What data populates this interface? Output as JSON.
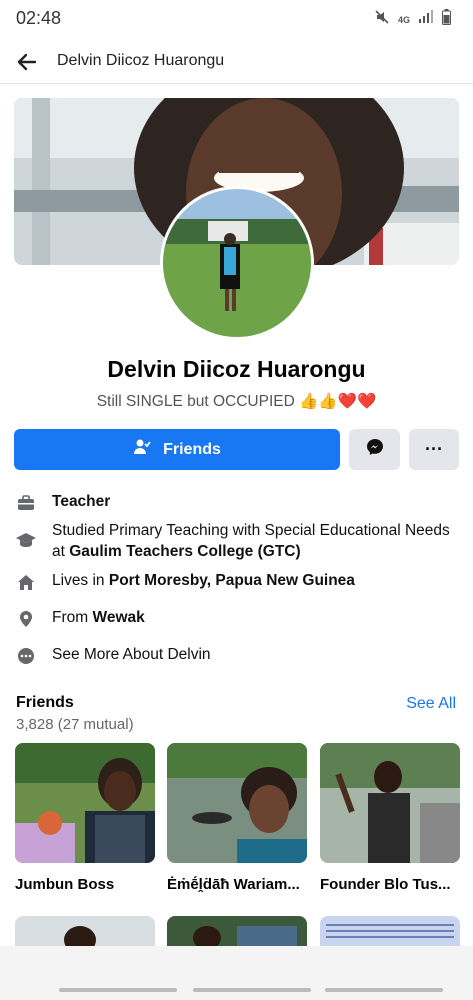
{
  "status_bar": {
    "time": "02:48",
    "network": "4G"
  },
  "top_bar": {
    "title": "Delvin Diicoz Huarongu"
  },
  "profile": {
    "name": "Delvin Diicoz Huarongu",
    "bio": "Still SINGLE but OCCUPIED 👍👍❤️❤️"
  },
  "actions": {
    "friends_label": "Friends",
    "more_label": "···"
  },
  "about": {
    "work": "Teacher",
    "education_prefix": "Studied Primary Teaching with Special Educational Needs at ",
    "education_school": "Gaulim Teachers College (GTC)",
    "lives_prefix": "Lives in ",
    "lives_place": "Port Moresby, Papua New Guinea",
    "from_prefix": "From ",
    "from_place": "Wewak",
    "see_more": "See More About Delvin"
  },
  "friends": {
    "heading": "Friends",
    "count": "3,828 (27 mutual)",
    "see_all": "See All",
    "items": [
      {
        "name": "Jumbun Boss"
      },
      {
        "name": "Ėṁḗḽḋāħ Wariam..."
      },
      {
        "name": "Founder Blo Tus..."
      }
    ]
  },
  "colors": {
    "accent": "#1877f2",
    "button_gray": "#e4e6eb"
  }
}
